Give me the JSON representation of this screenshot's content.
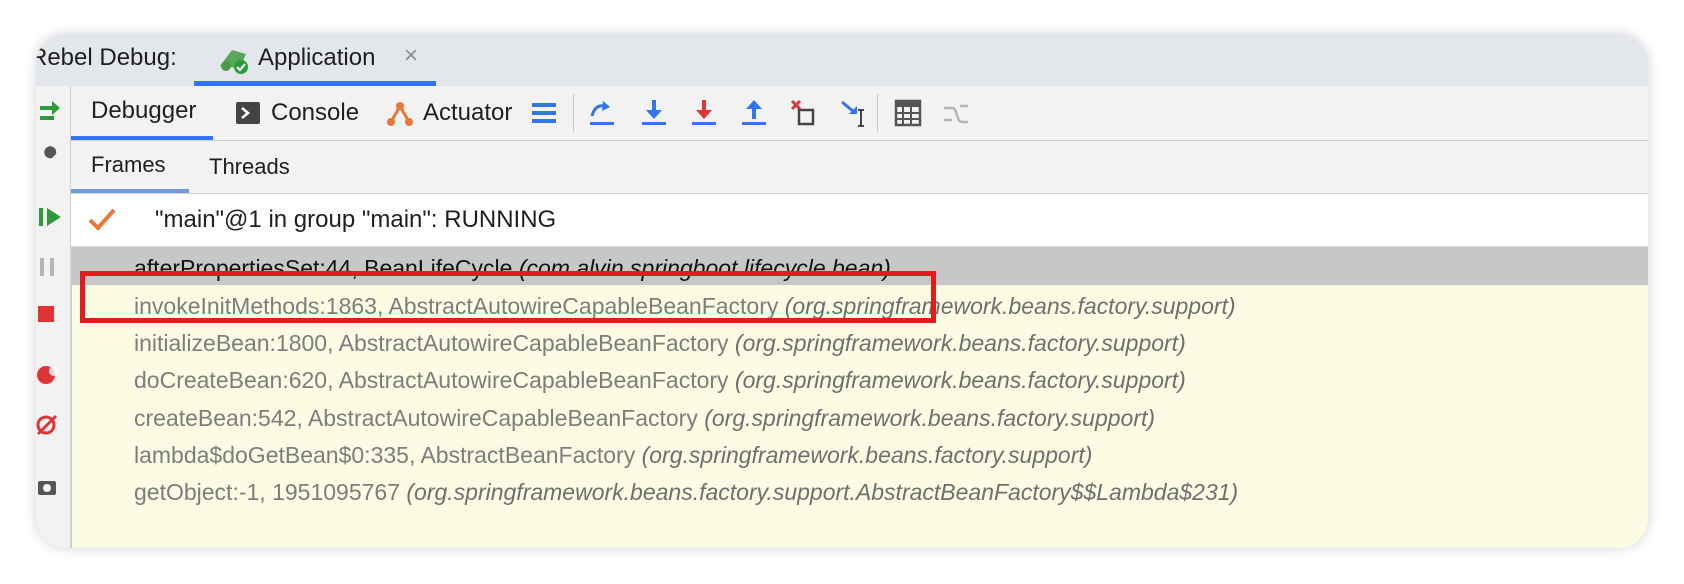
{
  "titlebar": {
    "prefix": "Rebel Debug:",
    "app_tab_label": "Application",
    "close_glyph": "×"
  },
  "main_toolbar": {
    "tabs": [
      {
        "label": "Debugger",
        "active": true
      },
      {
        "label": "Console",
        "icon": "console-icon"
      },
      {
        "label": "Actuator",
        "icon": "actuator-icon"
      }
    ],
    "icons": [
      "layout-menu-icon",
      "step-over-icon",
      "step-into-icon",
      "force-step-into-icon",
      "step-out-icon",
      "drop-frame-icon",
      "run-to-cursor-icon",
      "evaluate-expression-icon",
      "trace-stream-icon"
    ]
  },
  "sub_tabs": [
    {
      "label": "Frames",
      "active": true
    },
    {
      "label": "Threads"
    }
  ],
  "thread": {
    "text": "\"main\"@1 in group \"main\": RUNNING",
    "status_color": "#e8753a"
  },
  "frames": [
    {
      "method": "afterPropertiesSet:44, BeanLifeCycle ",
      "package": "(com.alvin.springboot.lifecycle.bean)",
      "selected": true
    },
    {
      "method": "invokeInitMethods:1863, AbstractAutowireCapableBeanFactory ",
      "package": "(org.springframework.beans.factory.support)",
      "highlighted": true
    },
    {
      "method": "initializeBean:1800, AbstractAutowireCapableBeanFactory ",
      "package": "(org.springframework.beans.factory.support)"
    },
    {
      "method": "doCreateBean:620, AbstractAutowireCapableBeanFactory ",
      "package": "(org.springframework.beans.factory.support)"
    },
    {
      "method": "createBean:542, AbstractAutowireCapableBeanFactory ",
      "package": "(org.springframework.beans.factory.support)"
    },
    {
      "method": "lambda$doGetBean$0:335, AbstractBeanFactory ",
      "package": "(org.springframework.beans.factory.support)"
    },
    {
      "method": "getObject:-1, 1951095767 ",
      "package": "(org.springframework.beans.factory.support.AbstractBeanFactory$$Lambda$231)"
    }
  ],
  "colors": {
    "accent": "#3574f0",
    "highlight_box": "#e61c1c",
    "frames_bg": "#fcfce5"
  }
}
